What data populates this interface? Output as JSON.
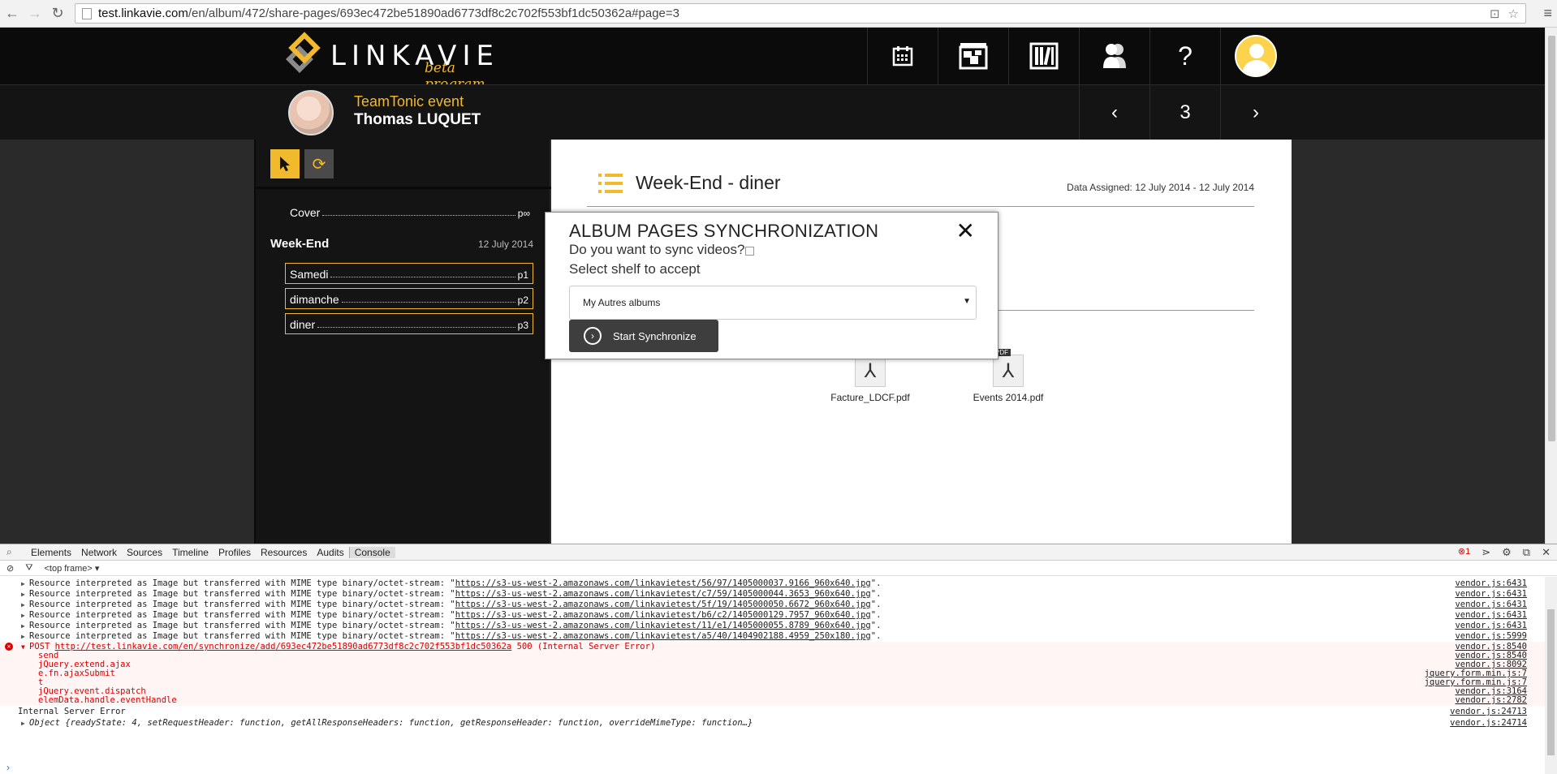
{
  "browser": {
    "url_host": "test.linkavie.com",
    "url_path": "/en/album/472/share-pages/693ec472be51890ad6773df8c2c702f553bf1dc50362a#page=3"
  },
  "header": {
    "logo_text": "LINKAVIE",
    "logo_sub": "beta program",
    "help_label": "?"
  },
  "event": {
    "title": "TeamTonic event",
    "name": "Thomas LUQUET"
  },
  "pager": {
    "prev": "‹",
    "current": "3",
    "next": "›"
  },
  "toc": {
    "cover": {
      "label": "Cover",
      "page": "p∞"
    },
    "section": {
      "title": "Week-End",
      "date": "12 July 2014"
    },
    "items": [
      {
        "label": "Samedi",
        "page": "p1"
      },
      {
        "label": "dimanche",
        "page": "p2"
      },
      {
        "label": "diner",
        "page": "p3"
      }
    ]
  },
  "main": {
    "title": "Week-End - diner",
    "assigned": "Data Assigned: 12 July 2014 - 12 July 2014",
    "files": [
      {
        "name": "Facture_LDCF.pdf"
      },
      {
        "name": "Events 2014.pdf",
        "tag": "PDF"
      }
    ]
  },
  "modal": {
    "title": "ALBUM PAGES SYNCHRONIZATION",
    "question": "Do you want to sync videos?",
    "shelf_label": "Select shelf to accept",
    "shelf_value": "My Autres albums",
    "button": "Start Synchronize"
  },
  "devtools": {
    "tabs": [
      "Elements",
      "Network",
      "Sources",
      "Timeline",
      "Profiles",
      "Resources",
      "Audits",
      "Console"
    ],
    "active_tab": "Console",
    "frame": "<top frame>",
    "error_count": "1",
    "resource_msg": "Resource interpreted as Image but transferred with MIME type binary/octet-stream: ",
    "resources": [
      {
        "url": "https://s3-us-west-2.amazonaws.com/linkavietest/56/97/1405000037.9166_960x640.jpg",
        "src": "vendor.js:6431"
      },
      {
        "url": "https://s3-us-west-2.amazonaws.com/linkavietest/c7/59/1405000044.3653_960x640.jpg",
        "src": "vendor.js:6431"
      },
      {
        "url": "https://s3-us-west-2.amazonaws.com/linkavietest/5f/19/1405000050.6672_960x640.jpg",
        "src": "vendor.js:6431"
      },
      {
        "url": "https://s3-us-west-2.amazonaws.com/linkavietest/b6/c2/1405000129.7957_960x640.jpg",
        "src": "vendor.js:6431"
      },
      {
        "url": "https://s3-us-west-2.amazonaws.com/linkavietest/11/e1/1405000055.8789_960x640.jpg",
        "src": "vendor.js:6431"
      },
      {
        "url": "https://s3-us-west-2.amazonaws.com/linkavietest/a5/40/1404902188.4959_250x180.jpg",
        "src": "vendor.js:5999"
      }
    ],
    "post_method": "POST",
    "post_url": "http://test.linkavie.com/en/synchronize/add/693ec472be51890ad6773df8c2c702f553bf1dc50362a",
    "post_status": "500 (Internal Server Error)",
    "post_src": "vendor.js:8540",
    "stack": [
      {
        "fn": "send",
        "src": "vendor.js:8540"
      },
      {
        "fn": "jQuery.extend.ajax",
        "src": "vendor.js:8092"
      },
      {
        "fn": "e.fn.ajaxSubmit",
        "src": "jquery.form.min.js:7"
      },
      {
        "fn": "t",
        "src": "jquery.form.min.js:7"
      },
      {
        "fn": "jQuery.event.dispatch",
        "src": "vendor.js:3164"
      },
      {
        "fn": "elemData.handle.eventHandle",
        "src": "vendor.js:2782"
      }
    ],
    "log_text": "Internal Server Error",
    "log_src": "vendor.js:24713",
    "object_text": "Object {readyState: 4, setRequestHeader: function, getAllResponseHeaders: function, getResponseHeader: function, overrideMimeType: function…}",
    "object_src": "vendor.js:24714"
  }
}
